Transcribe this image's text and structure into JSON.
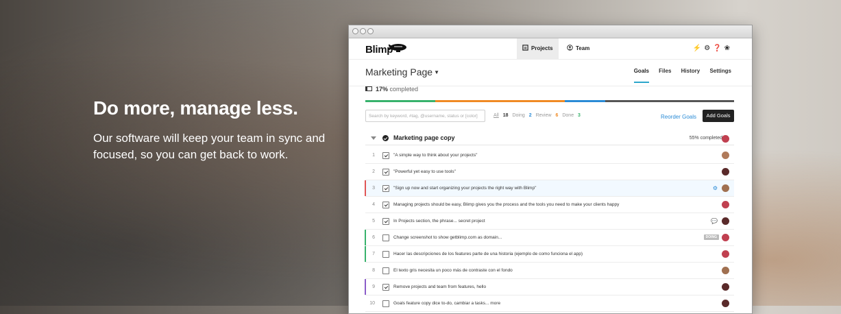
{
  "hero": {
    "headline": "Do more, manage less.",
    "body": "Our software will keep your team in sync and focused, so you can get back to work."
  },
  "app": {
    "logo": "Blimp",
    "nav_tabs": [
      {
        "label": "Projects",
        "icon": "projects-icon",
        "active": true
      },
      {
        "label": "Team",
        "icon": "team-icon",
        "active": false
      }
    ],
    "header_icons": [
      "bolt-icon",
      "gear-icon",
      "help-icon",
      "bug-icon"
    ],
    "project_title": "Marketing Page",
    "sub_tabs": [
      {
        "label": "Goals",
        "active": true
      },
      {
        "label": "Files",
        "active": false
      },
      {
        "label": "History",
        "active": false
      },
      {
        "label": "Settings",
        "active": false
      }
    ],
    "progress": {
      "percent": "17%",
      "label": "completed",
      "fraction": 0.17
    },
    "progress_bar_colors": [
      "#37b26c",
      "#f08a24",
      "#2a8bd6",
      "#555555"
    ],
    "progress_bar_shares": [
      0.19,
      0.35,
      0.11,
      0.35
    ],
    "search_placeholder": "Search by keyword, #tag, @username, status or [color]",
    "filters": {
      "all": "All",
      "all_count": "18",
      "doing": "Doing",
      "doing_count": "2",
      "review": "Review",
      "review_count": "6",
      "done": "Done",
      "done_count": "3"
    },
    "reorder_label": "Reorder Goals",
    "add_label": "Add Goals",
    "section": {
      "title": "Marketing page copy",
      "percent": "55% completed"
    },
    "rows": [
      {
        "num": "1",
        "text": "\"A simple way to think about your projects\"",
        "checked": true,
        "bar": "",
        "highlight": false,
        "avatar": "#b07a5a"
      },
      {
        "num": "2",
        "text": "\"Powerful yet easy to use tools\"",
        "checked": true,
        "bar": "",
        "highlight": false,
        "avatar": "#5a2a2a"
      },
      {
        "num": "3",
        "text": "\"Sign up now and start organizing your projects the right way with Blimp\"",
        "checked": true,
        "bar": "#e05555",
        "highlight": true,
        "avatar": "#a07050",
        "extra": "gear"
      },
      {
        "num": "4",
        "text": "Managing projects should be easy, Blimp gives you the process and the tools you need to make your clients happy",
        "checked": true,
        "bar": "",
        "highlight": false,
        "avatar": "#c04050"
      },
      {
        "num": "5",
        "text": "In Projects section, the phrase... secret project",
        "checked": true,
        "bar": "",
        "highlight": false,
        "avatar": "#5a2a2a",
        "extra": "comment"
      },
      {
        "num": "6",
        "text": "Change screenshot to show getblimp.com as domain...",
        "checked": false,
        "bar": "#37b26c",
        "highlight": false,
        "avatar": "#c04050",
        "badge": "DOING"
      },
      {
        "num": "7",
        "text": "Hacer las descripciones de los features parte de una historia (ejemplo de como funciona el app)",
        "checked": false,
        "bar": "#37b26c",
        "highlight": false,
        "avatar": "#c04050"
      },
      {
        "num": "8",
        "text": "El texto gris necesita un poco más de contraste con el fondo",
        "checked": false,
        "bar": "",
        "highlight": false,
        "avatar": "#a07050"
      },
      {
        "num": "9",
        "text": "Remove projects and team from features, hello",
        "checked": true,
        "bar": "#8a5cc9",
        "highlight": false,
        "avatar": "#5a2a2a"
      },
      {
        "num": "10",
        "text": "Goals feature copy dice to-do, cambiar a tasks... more",
        "checked": false,
        "bar": "",
        "highlight": false,
        "avatar": "#5a2a2a"
      }
    ]
  }
}
